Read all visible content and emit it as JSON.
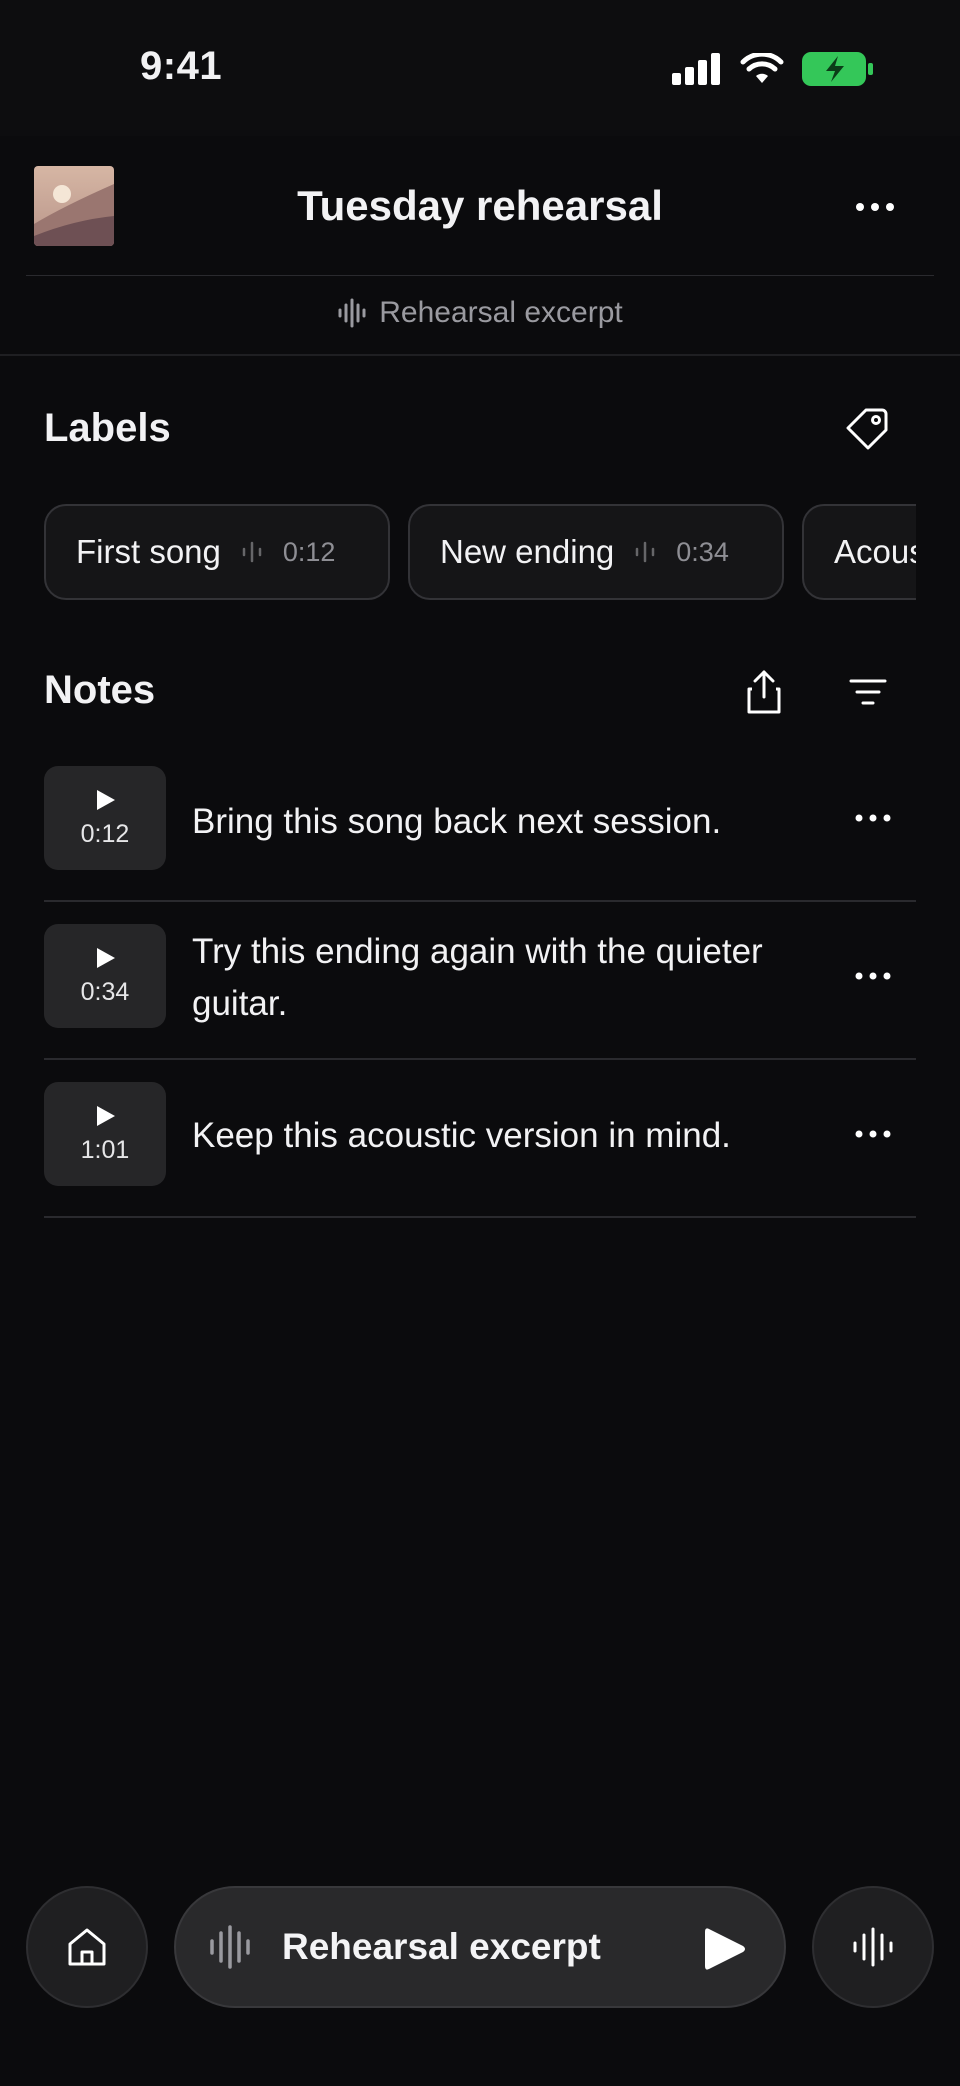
{
  "status": {
    "time": "9:41"
  },
  "header": {
    "title": "Tuesday rehearsal",
    "subtitle": "Rehearsal excerpt"
  },
  "labels": {
    "title": "Labels",
    "chips": [
      {
        "label": "First song",
        "time": "0:12"
      },
      {
        "label": "New ending",
        "time": "0:34"
      },
      {
        "label": "Acous",
        "time": ""
      }
    ]
  },
  "notes": {
    "title": "Notes",
    "items": [
      {
        "time": "0:12",
        "text": "Bring this song back next session."
      },
      {
        "time": "0:34",
        "text": "Try this ending again with the quieter guitar."
      },
      {
        "time": "1:01",
        "text": "Keep this acoustic version in mind."
      }
    ]
  },
  "player": {
    "title": "Rehearsal excerpt"
  },
  "colors": {
    "background": "#0b0b0d",
    "battery": "#34c759",
    "muted_text": "#9a9aa0"
  },
  "icons": [
    "signal-icon",
    "wifi-icon",
    "battery-icon",
    "more-icon",
    "waveform-icon",
    "tag-icon",
    "share-icon",
    "filter-icon",
    "play-icon",
    "home-icon"
  ]
}
